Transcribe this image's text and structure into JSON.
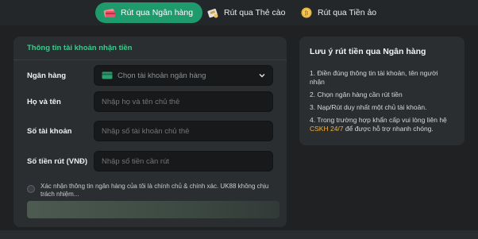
{
  "tabs": [
    {
      "label": "Rút qua Ngân hàng",
      "icon": "bank-card-icon",
      "active": true
    },
    {
      "label": "Rút qua Thẻ cào",
      "icon": "scratch-card-icon",
      "active": false
    },
    {
      "label": "Rút qua Tiền ảo",
      "icon": "crypto-coin-icon",
      "active": false
    }
  ],
  "form": {
    "section_title": "Thông tin tài khoản nhận tiền",
    "bank": {
      "label": "Ngân hàng",
      "placeholder": "Chọn tài khoản ngân hàng"
    },
    "name": {
      "label": "Họ và tên",
      "placeholder": "Nhập họ và tên chủ thẻ"
    },
    "account": {
      "label": "Số tài khoản",
      "placeholder": "Nhập số tài khoản chủ thẻ"
    },
    "amount": {
      "label": "Số tiền rút (VNĐ)",
      "placeholder": "Nhập số tiền cần rút"
    },
    "consent_text": "Xác nhận thông tin ngân hàng của tôi là chính chủ & chính xác. UK88 không chịu trách nhiệm..."
  },
  "notes": {
    "title": "Lưu ý rút tiền qua Ngân hàng",
    "items": [
      "1. Điền đúng thông tin tài khoản, tên người nhận",
      "2. Chọn ngân hàng cần rút tiền",
      "3. Nạp/Rút duy nhất một chủ tài khoản."
    ],
    "item4_before": "4. Trong trường hợp khẩn cấp vui lòng liên hệ ",
    "item4_link": "CSKH 24/7",
    "item4_after": " để được hỗ trợ nhanh chóng."
  },
  "colors": {
    "accent": "#1f9a6c",
    "section_title": "#3fc98e",
    "link": "#f0b23a"
  }
}
